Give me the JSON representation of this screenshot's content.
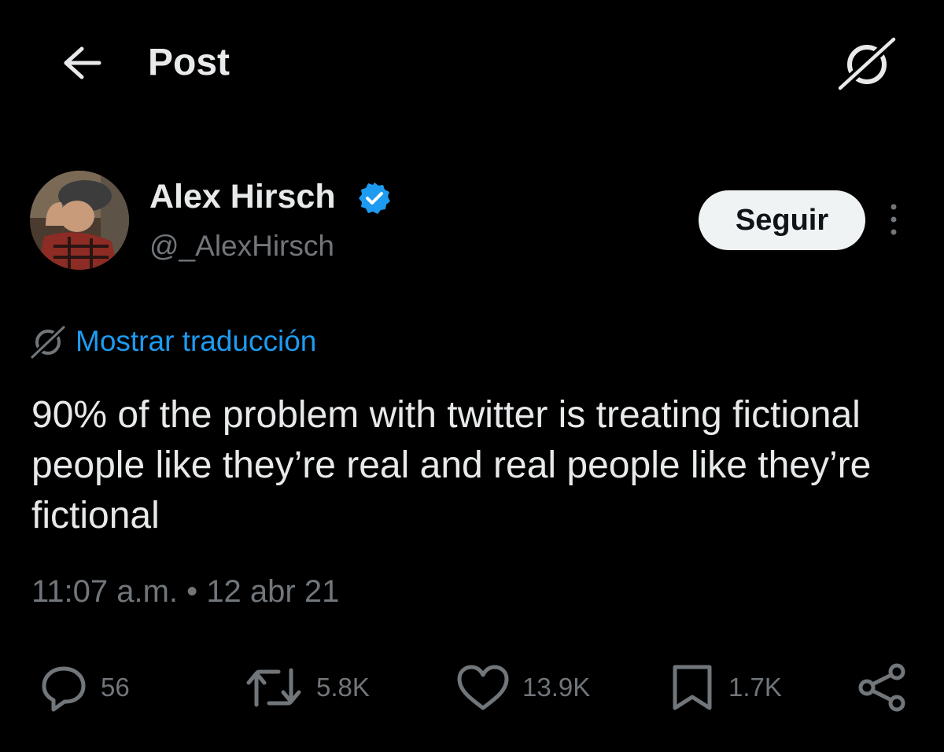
{
  "header": {
    "title": "Post",
    "back_icon": "arrow-left-icon",
    "grok_icon": "grok-icon"
  },
  "author": {
    "display_name": "Alex Hirsch",
    "handle": "@_AlexHirsch",
    "verified_icon": "verified-badge-icon",
    "follow_label": "Seguir",
    "more_icon": "more-vertical-icon"
  },
  "post": {
    "translate_label": "Mostrar traducción",
    "text": "90% of the problem with twitter is treating fictional people like they’re real and real people like they’re fictional",
    "time": "11:07 a.m.",
    "separator": "•",
    "date": "12 abr 21"
  },
  "actions": {
    "replies": "56",
    "reposts": "5.8K",
    "likes": "13.9K",
    "bookmarks": "1.7K",
    "share_icon": "share-icon"
  },
  "colors": {
    "background": "#000000",
    "text_primary": "#e7e9ea",
    "text_secondary": "#71767b",
    "accent": "#1d9bf0",
    "follow_button_bg": "#eff3f4"
  }
}
